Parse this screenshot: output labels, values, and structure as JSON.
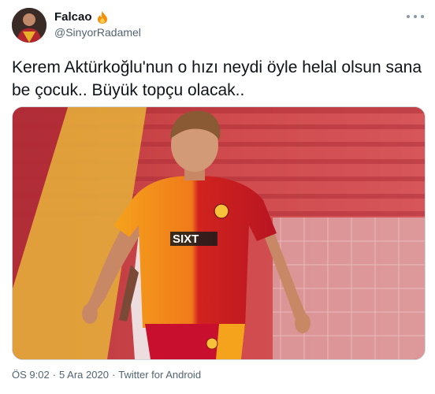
{
  "author": {
    "display_name": "Falcao",
    "badge_icon": "fire-emoji-icon",
    "handle": "@SinyorRadamel"
  },
  "tweet": {
    "line1": "Kerem Aktürkoğlu'nun o hızı neydi öyle helal olsun sana",
    "line2": "be çocuk.. Büyük topçu olacak..",
    "image_alt": "Galatasaray player in red-orange jersey on the pitch"
  },
  "meta": {
    "time": "ÖS 9:02",
    "dot1": "·",
    "date": "5 Ara 2020",
    "dot2": "·",
    "source": "Twitter for Android"
  },
  "colors": {
    "jersey_yellow": "#f5a21c",
    "jersey_red": "#c8102e",
    "stadium_red": "#c9343c"
  }
}
